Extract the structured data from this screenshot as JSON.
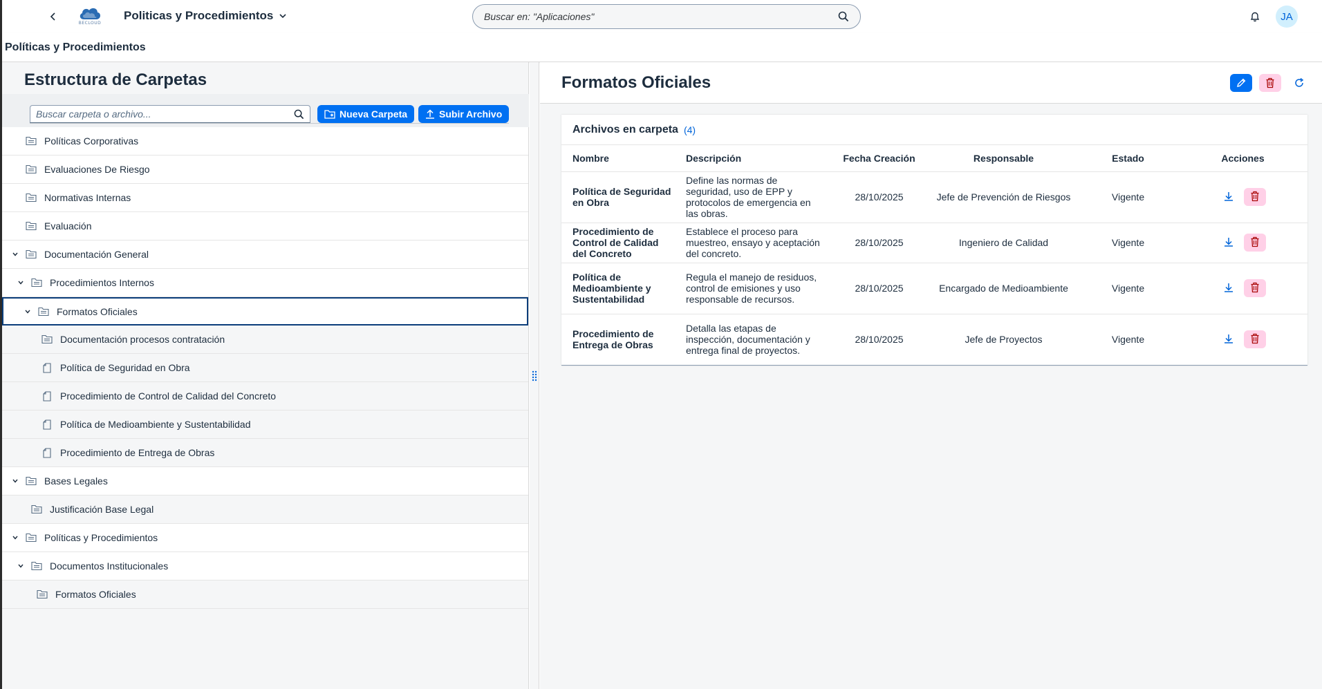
{
  "shell": {
    "app_title": "Politicas y Procedimientos",
    "logo_text": "BECLOUD",
    "search_placeholder": "Buscar en: \"Aplicaciones\"",
    "avatar_initials": "JA"
  },
  "subheader": {
    "title": "Políticas y Procedimientos"
  },
  "left_panel": {
    "title": "Estructura de Carpetas",
    "search_placeholder": "Buscar carpeta o archivo...",
    "new_folder_label": "Nueva Carpeta",
    "upload_label": "Subir Archivo"
  },
  "tree": {
    "items": [
      {
        "label": "Políticas Corporativas",
        "level": 0,
        "type": "folder",
        "expanded": false
      },
      {
        "label": "Evaluaciones De Riesgo",
        "level": 0,
        "type": "folder",
        "expanded": false
      },
      {
        "label": "Normativas Internas",
        "level": 0,
        "type": "folder",
        "expanded": false
      },
      {
        "label": "Evaluación",
        "level": 0,
        "type": "folder",
        "expanded": false
      },
      {
        "label": "Documentación General",
        "level": 0,
        "type": "folder",
        "expanded": true
      },
      {
        "label": "Procedimientos Internos",
        "level": 1,
        "type": "folder",
        "expanded": true
      },
      {
        "label": "Formatos Oficiales",
        "level": 2,
        "type": "folder",
        "expanded": true,
        "selected": true
      },
      {
        "label": "Documentación procesos contratación",
        "level": 3,
        "type": "folder",
        "expanded": false
      },
      {
        "label": "Política de Seguridad en Obra",
        "level": 3,
        "type": "file"
      },
      {
        "label": "Procedimiento de Control de Calidad del Concreto",
        "level": 3,
        "type": "file"
      },
      {
        "label": "Política de Medioambiente y Sustentabilidad",
        "level": 3,
        "type": "file"
      },
      {
        "label": "Procedimiento de Entrega de Obras",
        "level": 3,
        "type": "file"
      },
      {
        "label": "Bases Legales",
        "level": 0,
        "type": "folder",
        "expanded": true
      },
      {
        "label": "Justificación Base Legal",
        "level": 1,
        "type": "folder",
        "expanded": false
      },
      {
        "label": "Políticas y Procedimientos",
        "level": 0,
        "type": "folder",
        "expanded": true
      },
      {
        "label": "Documentos Institucionales",
        "level": 1,
        "type": "folder",
        "expanded": true
      },
      {
        "label": "Formatos Oficiales",
        "level": 2,
        "type": "folder",
        "expanded": false
      }
    ]
  },
  "right_panel": {
    "title": "Formatos Oficiales",
    "card_title": "Archivos en carpeta",
    "card_count": "(4)",
    "columns": [
      "Nombre",
      "Descripción",
      "Fecha Creación",
      "Responsable",
      "Estado",
      "Acciones"
    ],
    "rows": [
      {
        "name": "Política de Seguridad en Obra",
        "description": "Define las normas de seguridad, uso de EPP y protocolos de emergencia en las obras.",
        "date": "28/10/2025",
        "owner": "Jefe de Prevención de Riesgos",
        "status": "Vigente"
      },
      {
        "name": "Procedimiento de Control de Calidad del Concreto",
        "description": "Establece el proceso para muestreo, ensayo y aceptación del concreto.",
        "date": "28/10/2025",
        "owner": "Ingeniero de Calidad",
        "status": "Vigente"
      },
      {
        "name": "Política de Medioambiente y Sustentabilidad",
        "description": "Regula el manejo de residuos, control de emisiones y uso responsable de recursos.",
        "date": "28/10/2025",
        "owner": "Encargado de Medioambiente",
        "status": "Vigente"
      },
      {
        "name": "Procedimiento de Entrega de Obras",
        "description": "Detalla las etapas de inspección, documentación y entrega final de proyectos.",
        "date": "28/10/2025",
        "owner": "Jefe de Proyectos",
        "status": "Vigente"
      }
    ]
  },
  "colors": {
    "accent": "#0070f2",
    "negative_bg": "#ffd0e7",
    "negative_icon": "#aa0808",
    "selection_border": "#0a3d7a"
  }
}
